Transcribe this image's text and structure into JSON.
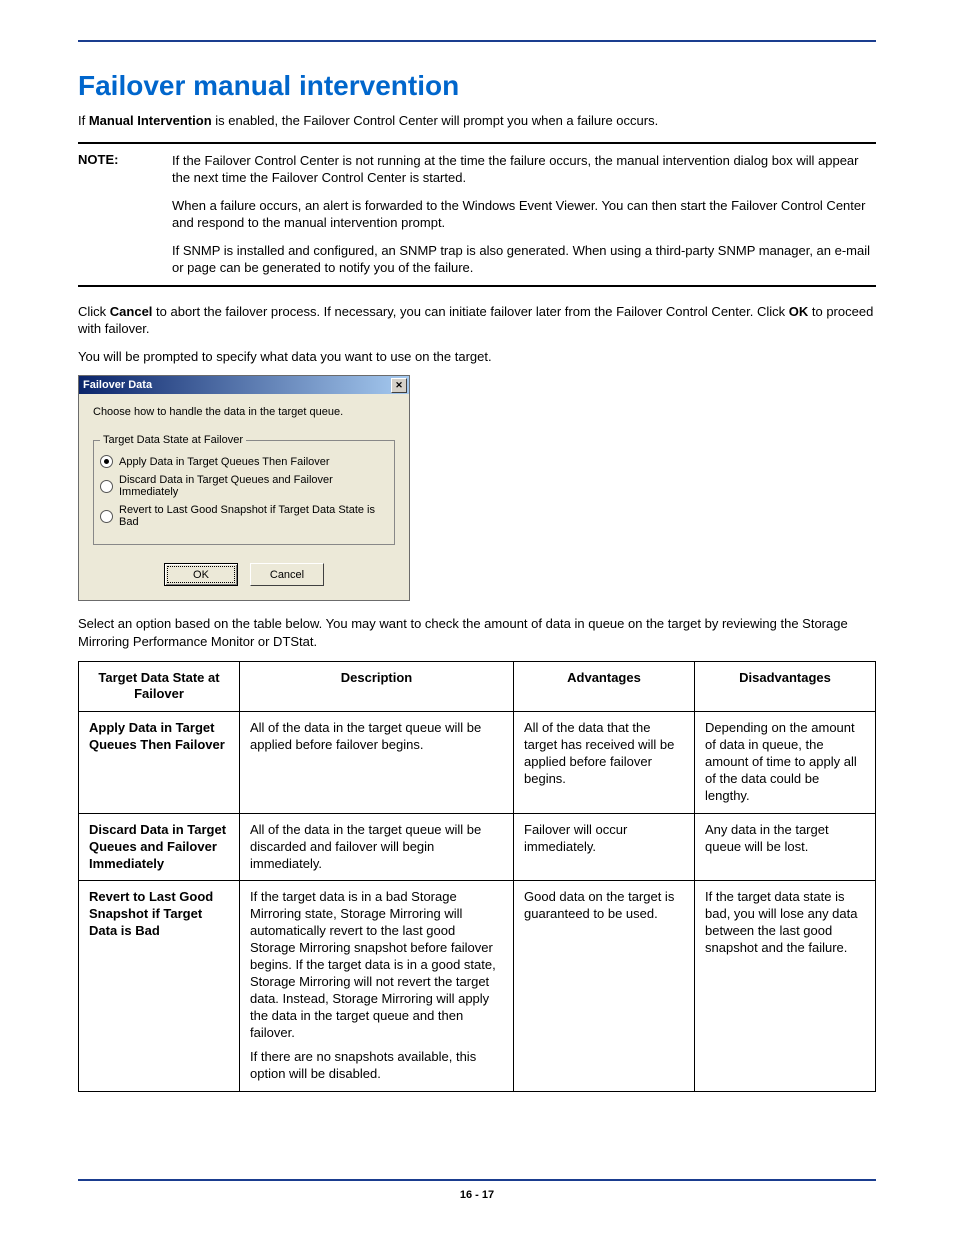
{
  "title": "Failover manual intervention",
  "intro_prefix": "If ",
  "intro_bold": "Manual Intervention",
  "intro_suffix": " is enabled, the Failover Control Center will prompt you when a failure occurs.",
  "note_label": "NOTE:",
  "note_paragraphs": [
    "If the Failover Control Center is not running at the time the failure occurs, the manual intervention dialog box will appear the next time the Failover Control Center is started.",
    "When a failure occurs, an alert is forwarded to the Windows Event Viewer. You can then start the Failover Control Center and respond to the manual intervention prompt.",
    "If SNMP is installed and configured, an SNMP trap is also generated. When using a third-party SNMP manager, an e-mail or page can be generated to notify you of the failure."
  ],
  "click_prefix": "Click ",
  "cancel_bold": "Cancel",
  "click_mid": " to abort the failover process. If necessary, you can initiate failover later from the Failover Control Center. Click ",
  "ok_bold": "OK",
  "click_suffix": " to proceed with failover.",
  "prompt_text": "You will be prompted to specify what data you want to use on the target.",
  "dialog": {
    "title": "Failover Data",
    "instruction": "Choose how to handle the data in the target queue.",
    "group_label": "Target Data State at Failover",
    "options": [
      "Apply Data in Target Queues Then Failover",
      "Discard Data in Target Queues and Failover Immediately",
      "Revert to Last Good Snapshot if Target Data State is Bad"
    ],
    "ok": "OK",
    "cancel": "Cancel"
  },
  "select_text": "Select an option based on the table below. You may want to check the amount of data in queue on the target by reviewing the Storage Mirroring Performance Monitor or DTStat.",
  "table": {
    "headers": [
      "Target Data State at Failover",
      "Description",
      "Advantages",
      "Disadvantages"
    ],
    "rows": [
      {
        "name": "Apply Data in Target Queues Then Failover",
        "desc": [
          "All of the data in the target queue will be applied before failover begins."
        ],
        "adv": "All of the data that the target has received will be applied before failover begins.",
        "dis": "Depending on the amount of data in queue, the amount of time to apply all of the data could be lengthy."
      },
      {
        "name": "Discard Data in Target Queues and Failover Immediately",
        "desc": [
          "All of the data in the target queue will be discarded and failover will begin immediately."
        ],
        "adv": "Failover will occur immediately.",
        "dis": "Any data in the target queue will be lost."
      },
      {
        "name": "Revert to Last Good Snapshot if Target Data is Bad",
        "desc": [
          "If the target data is in a bad Storage Mirroring state, Storage Mirroring will automatically revert to the last good Storage Mirroring snapshot before failover begins. If the target data is in a good state, Storage Mirroring will not revert the target data. Instead, Storage Mirroring will apply the data in the target queue and then failover.",
          "If there are no snapshots available, this option will be disabled."
        ],
        "adv": "Good data on the target is guaranteed to be used.",
        "dis": "If the target data state is bad, you will lose any data between the last good snapshot and the failure."
      }
    ]
  },
  "page_num": "16 - 17"
}
